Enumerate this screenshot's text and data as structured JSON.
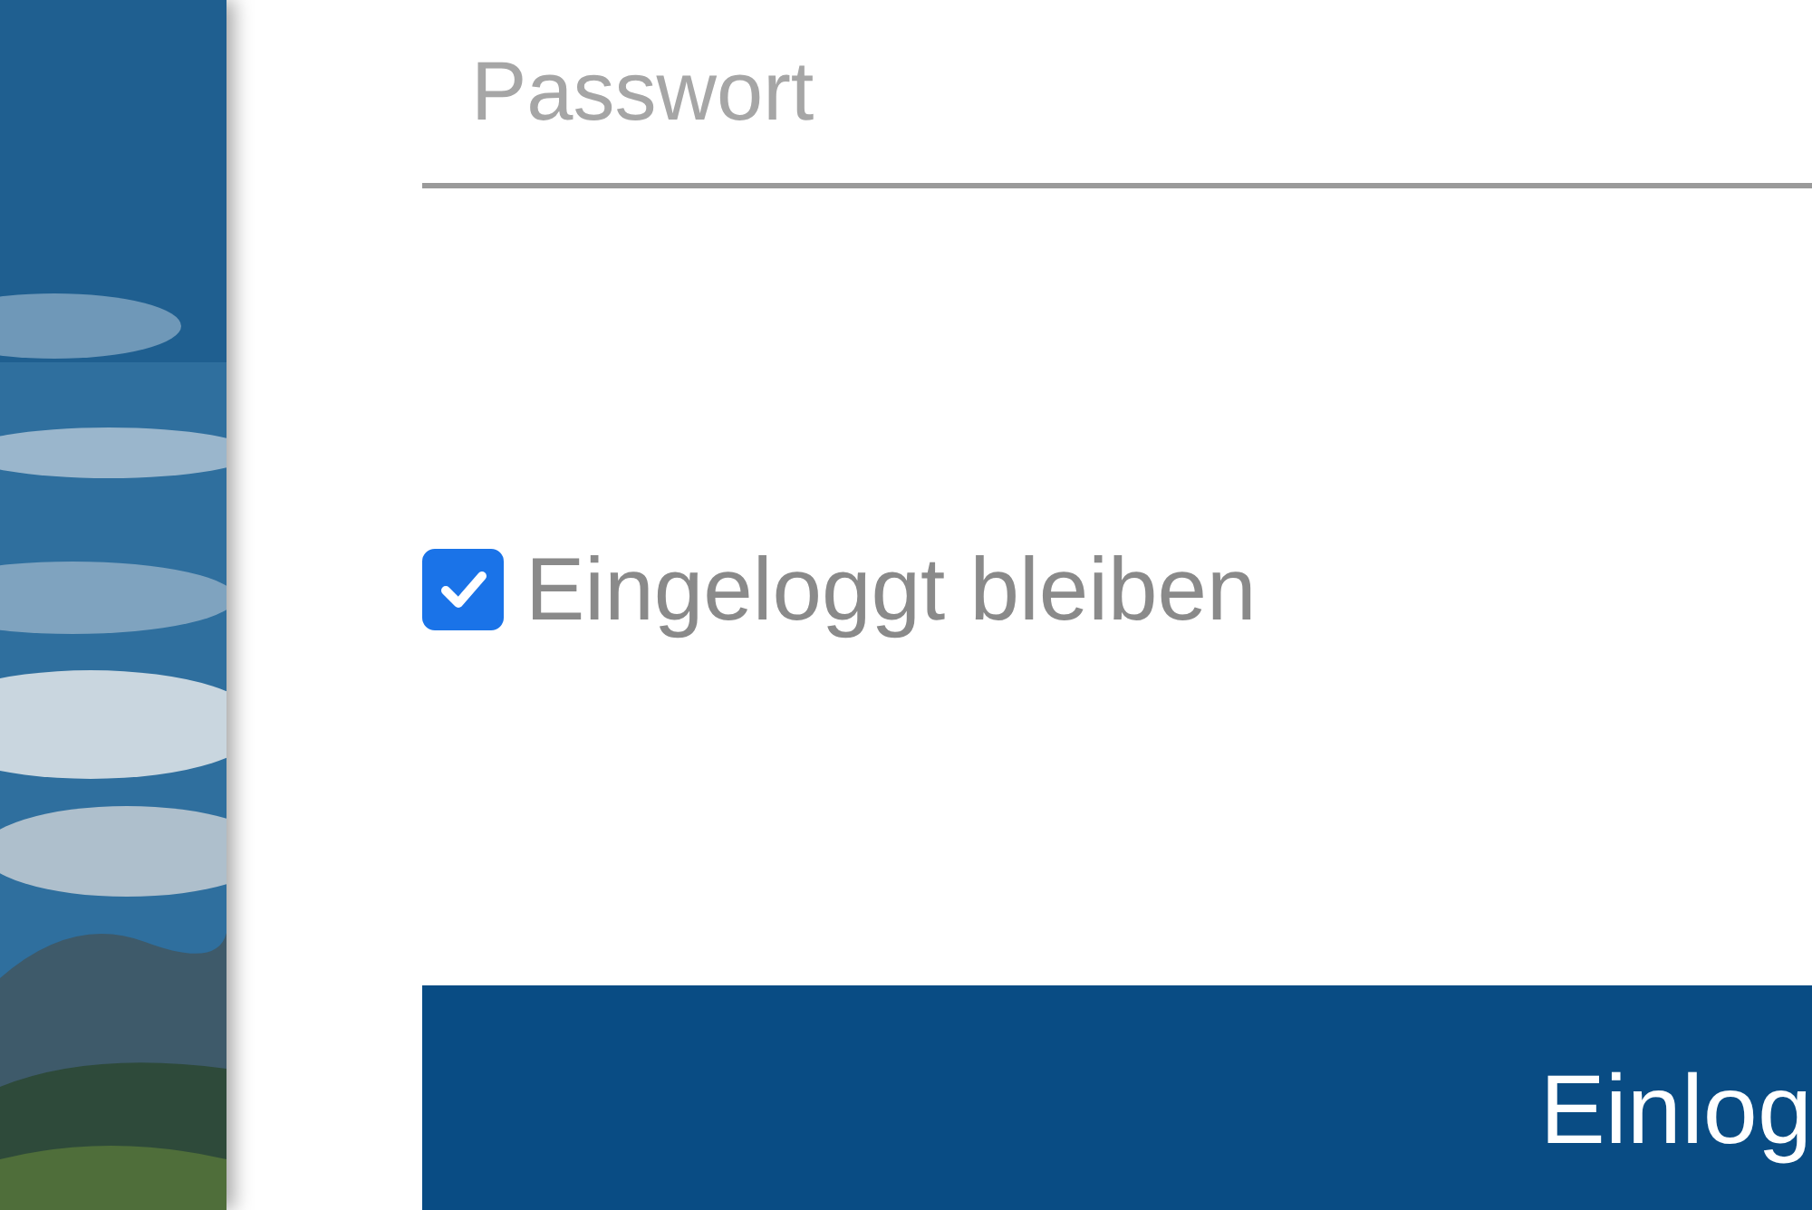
{
  "password_field": {
    "placeholder": "Passwort"
  },
  "remember_me": {
    "label": "Eingeloggt bleiben",
    "checked": true
  },
  "login_button": {
    "label": "Einlog"
  }
}
